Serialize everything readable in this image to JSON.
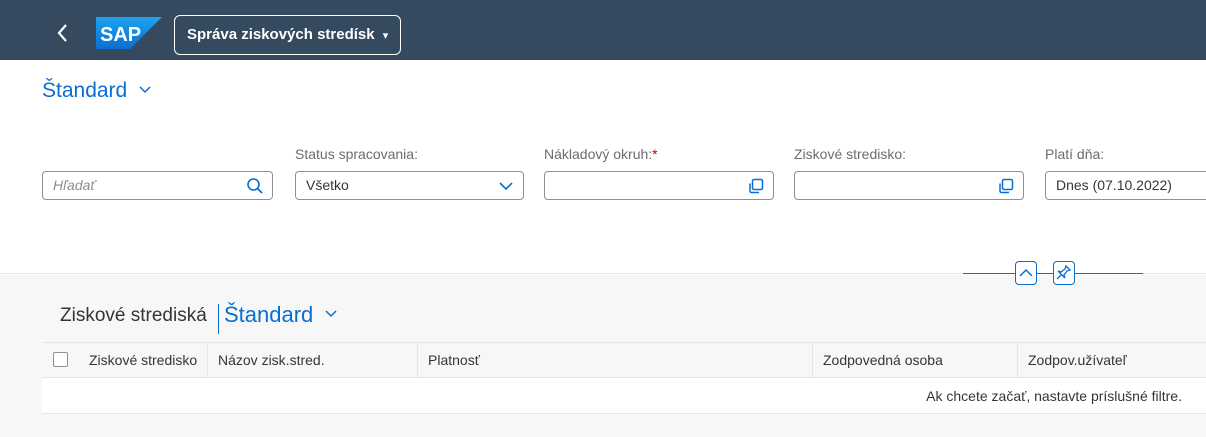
{
  "shell": {
    "back_icon": "chevron-left-icon",
    "logo_text": "SAP",
    "app_title": "Správa ziskových stredísk",
    "app_title_caret": "▾",
    "colors": {
      "shell_bg": "#354a5f",
      "logo_blue": "#0a6ed1",
      "accent": "#0a6ed1"
    }
  },
  "filter_bar": {
    "variant_label": "Štandard",
    "variant_chevron": "⌄",
    "search": {
      "placeholder": "Hľadať",
      "icon": "search-icon"
    },
    "status": {
      "label": "Status spracovania:",
      "value": "Všetko",
      "icon": "chevron-down-icon"
    },
    "cost_area": {
      "label": "Nákladový okruh:",
      "required_mark": "*",
      "value": "",
      "icon": "value-help-icon"
    },
    "profit_center": {
      "label": "Ziskové stredisko:",
      "value": "",
      "icon": "value-help-icon"
    },
    "valid_on": {
      "label": "Platí dňa:",
      "value": "Dnes (07.10.2022)"
    }
  },
  "splitter": {
    "collapse_icon": "chevron-up-icon",
    "pin_icon": "pin-icon"
  },
  "table": {
    "title": "Ziskové strediská",
    "variant_label": "Štandard",
    "variant_chevron": "⌄",
    "columns": [
      "Ziskové stredisko",
      "Názov zisk.stred.",
      "Platnosť",
      "Zodpovedná osoba",
      "Zodpov.užívateľ"
    ],
    "no_data_text": "Ak chcete začať, nastavte príslušné filtre."
  }
}
